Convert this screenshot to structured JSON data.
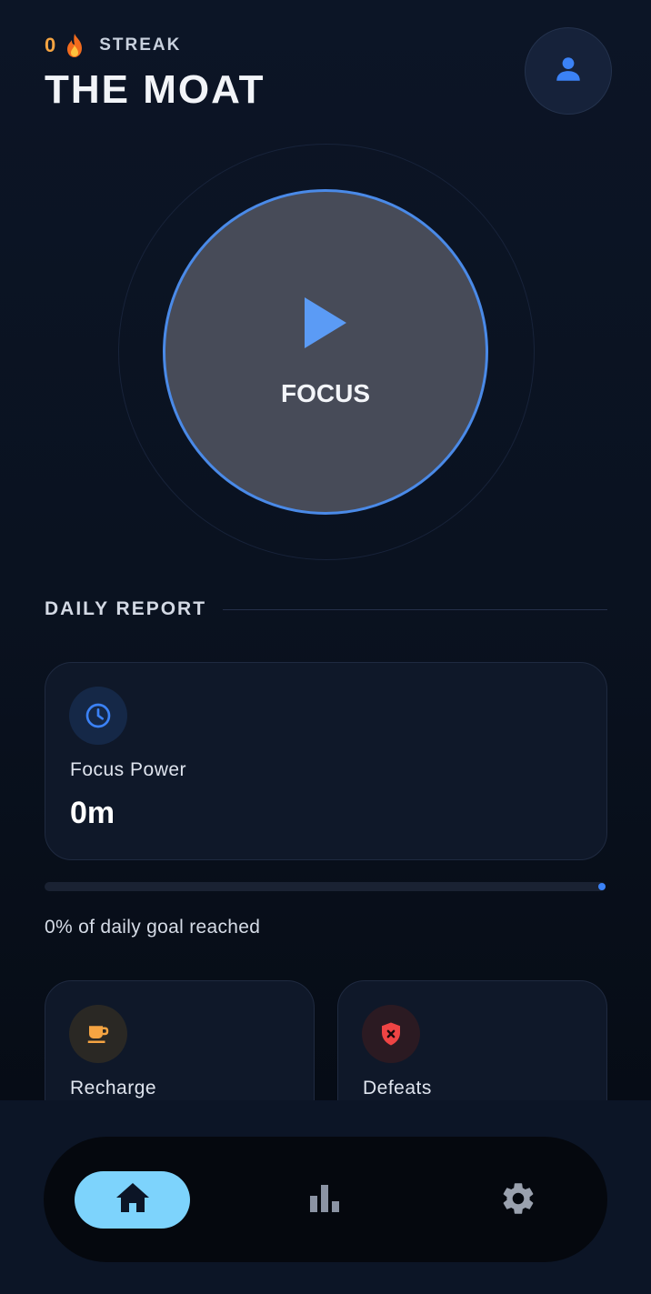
{
  "header": {
    "streak_count": "0",
    "streak_label": "STREAK",
    "title": "THE MOAT"
  },
  "focus": {
    "label": "FOCUS"
  },
  "daily_report": {
    "title": "DAILY REPORT",
    "focus_power": {
      "label": "Focus Power",
      "value": "0m",
      "icon": "clock-icon"
    },
    "goal_progress": 0,
    "goal_text": "0% of daily goal reached",
    "recharge": {
      "label": "Recharge",
      "icon": "coffee-icon"
    },
    "defeats": {
      "label": "Defeats",
      "icon": "shield-x-icon"
    }
  },
  "nav": {
    "items": [
      {
        "name": "home",
        "icon": "home-icon",
        "active": true
      },
      {
        "name": "stats",
        "icon": "bar-chart-icon",
        "active": false
      },
      {
        "name": "settings",
        "icon": "gear-icon",
        "active": false
      }
    ]
  },
  "colors": {
    "accent_blue": "#4a8ae8",
    "streak_orange": "#f5a442",
    "nav_active": "#7dd3fc",
    "defeat_red": "#ef4444",
    "recharge_amber": "#f5a442"
  }
}
